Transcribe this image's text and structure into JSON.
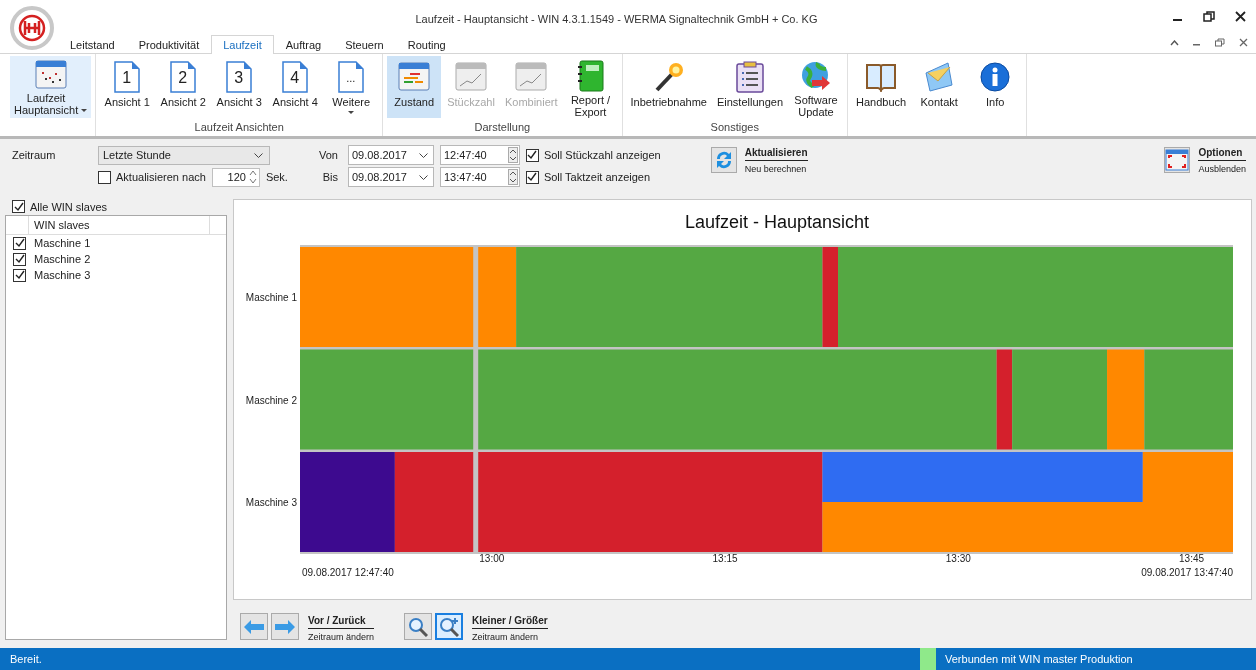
{
  "window": {
    "title": "Laufzeit - Hauptansicht - WIN 4.3.1.1549 - WERMA Signaltechnik GmbH + Co. KG"
  },
  "tabs": [
    {
      "label": "Leitstand",
      "selected": false
    },
    {
      "label": "Produktivität",
      "selected": false
    },
    {
      "label": "Laufzeit",
      "selected": true
    },
    {
      "label": "Auftrag",
      "selected": false
    },
    {
      "label": "Steuern",
      "selected": false
    },
    {
      "label": "Routing",
      "selected": false
    }
  ],
  "ribbon": [
    {
      "items": [
        {
          "kind": "chart-window",
          "label": "Laufzeit\nHauptansicht",
          "selected": true,
          "disabled": false,
          "dropdown": true
        }
      ]
    },
    {
      "label": "Laufzeit Ansichten",
      "items": [
        {
          "kind": "page",
          "glyph": "1",
          "label": "Ansicht 1",
          "selected": false,
          "disabled": false,
          "dropdown": false
        },
        {
          "kind": "page",
          "glyph": "2",
          "label": "Ansicht 2",
          "selected": false,
          "disabled": false,
          "dropdown": false
        },
        {
          "kind": "page",
          "glyph": "3",
          "label": "Ansicht 3",
          "selected": false,
          "disabled": false,
          "dropdown": false
        },
        {
          "kind": "page",
          "glyph": "4",
          "label": "Ansicht 4",
          "selected": false,
          "disabled": false,
          "dropdown": false
        },
        {
          "kind": "page",
          "glyph": "...",
          "label": "Weitere",
          "selected": false,
          "disabled": false,
          "dropdown": true
        }
      ]
    },
    {
      "label": "Darstellung",
      "items": [
        {
          "kind": "state-window",
          "label": "Zustand",
          "selected": true,
          "disabled": false,
          "dropdown": false
        },
        {
          "kind": "line-window",
          "label": "Stückzahl",
          "selected": false,
          "disabled": true,
          "dropdown": false
        },
        {
          "kind": "line-window",
          "label": "Kombiniert",
          "selected": false,
          "disabled": true,
          "dropdown": false
        },
        {
          "kind": "notebook",
          "label": "Report /\nExport",
          "selected": false,
          "disabled": false,
          "dropdown": false
        }
      ]
    },
    {
      "label": "Sonstiges",
      "items": [
        {
          "kind": "wand",
          "label": "Inbetriebnahme",
          "selected": false,
          "disabled": false,
          "dropdown": false
        },
        {
          "kind": "clipboard",
          "label": "Einstellungen",
          "selected": false,
          "disabled": false,
          "dropdown": false
        },
        {
          "kind": "globe",
          "label": "Software\nUpdate",
          "selected": false,
          "disabled": false,
          "dropdown": false
        }
      ]
    },
    {
      "items": [
        {
          "kind": "book",
          "label": "Handbuch",
          "selected": false,
          "disabled": false,
          "dropdown": false
        },
        {
          "kind": "envelope",
          "label": "Kontakt",
          "selected": false,
          "disabled": false,
          "dropdown": false
        },
        {
          "kind": "info",
          "label": "Info",
          "selected": false,
          "disabled": false,
          "dropdown": false
        }
      ]
    }
  ],
  "filter": {
    "zeitraum_label": "Zeitraum",
    "zeitraum_value": "Letzte Stunde",
    "auto_refresh": {
      "label": "Aktualisieren nach",
      "checked": false
    },
    "interval": "120",
    "interval_unit": "Sek.",
    "von_label": "Von",
    "von_date": "09.08.2017",
    "von_time": "12:47:40",
    "bis_label": "Bis",
    "bis_date": "09.08.2017",
    "bis_time": "13:47:40",
    "options": [
      {
        "label": "Soll Stückzahl anzeigen",
        "checked": true
      },
      {
        "label": "Soll Taktzeit anzeigen",
        "checked": true
      }
    ],
    "refresh": {
      "title": "Aktualisieren",
      "subtitle": "Neu berechnen"
    },
    "toggle": {
      "title": "Optionen",
      "subtitle": "Ausblenden"
    }
  },
  "slaves": {
    "all": {
      "label": "Alle WIN slaves",
      "checked": true
    },
    "column": "WIN slaves",
    "items": [
      {
        "label": "Maschine 1",
        "checked": true
      },
      {
        "label": "Maschine 2",
        "checked": true
      },
      {
        "label": "Maschine 3",
        "checked": true
      }
    ]
  },
  "chart": {
    "title": "Laufzeit - Hauptansicht",
    "rows": [
      "Maschine 1",
      "Maschine 2",
      "Maschine 3"
    ],
    "tick_labels": [
      "13:00",
      "13:15",
      "13:30",
      "13:45"
    ],
    "start_label": "09.08.2017 12:47:40",
    "end_label": "09.08.2017 13:47:40"
  },
  "navigation": [
    {
      "buttons": [
        {
          "kind": "back",
          "selected": false
        },
        {
          "kind": "forward",
          "selected": false
        }
      ],
      "title": "Vor / Zurück",
      "subtitle": "Zeitraum ändern"
    },
    {
      "buttons": [
        {
          "kind": "zoom-out",
          "selected": false
        },
        {
          "kind": "zoom-in",
          "selected": true
        }
      ],
      "title": "Kleiner / Größer",
      "subtitle": "Zeitraum ändern"
    }
  ],
  "status_bar": {
    "text": "Bereit.",
    "connection": "Verbunden mit WIN master Produktion",
    "connected": true
  }
}
